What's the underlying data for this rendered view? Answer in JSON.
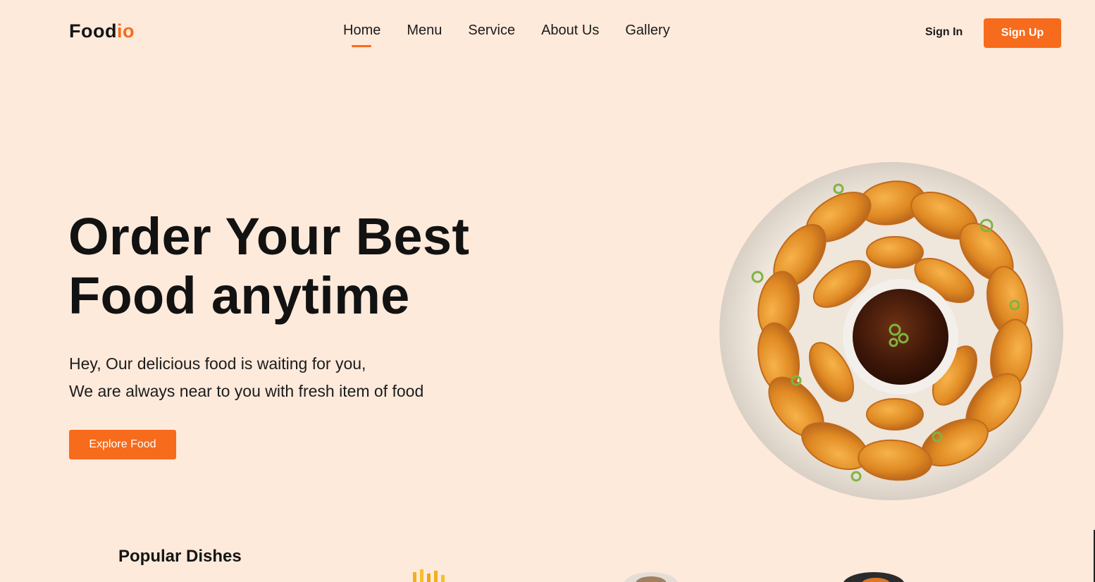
{
  "brand": {
    "name_part1": "Food",
    "name_part2": "io",
    "accent_color": "#f76b1c"
  },
  "nav": {
    "items": [
      {
        "label": "Home",
        "active": true
      },
      {
        "label": "Menu",
        "active": false
      },
      {
        "label": "Service",
        "active": false
      },
      {
        "label": "About Us",
        "active": false
      },
      {
        "label": "Gallery",
        "active": false
      }
    ]
  },
  "auth": {
    "sign_in": "Sign In",
    "sign_up": "Sign Up"
  },
  "hero": {
    "title_line1": "Order Your Best",
    "title_line2": "Food anytime",
    "subtitle_line1": "Hey, Our delicious food is waiting for you,",
    "subtitle_line2": "We are always near to you with fresh item of food",
    "cta": "Explore Food",
    "image_icon": "fried-chicken-plate-image"
  },
  "popular": {
    "title": "Popular Dishes"
  },
  "colors": {
    "background": "#feeadb",
    "primary": "#f76b1c",
    "text": "#121212"
  }
}
